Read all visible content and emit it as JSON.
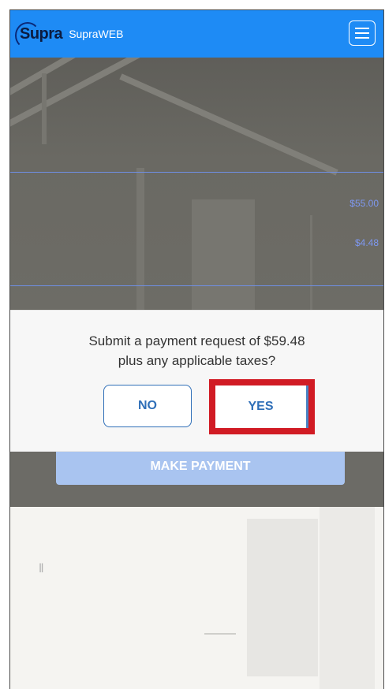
{
  "header": {
    "logo_text": "Supra",
    "brand_text": "SupraWEB",
    "menu_icon": "hamburger-menu-icon"
  },
  "background": {
    "price_1": "$55.00",
    "price_2": "$4.48"
  },
  "dialog": {
    "line1": "Submit a payment request of $59.48",
    "line2": "plus any applicable taxes?",
    "no_label": "NO",
    "yes_label": "YES",
    "highlight_color": "#d11b24"
  },
  "payment": {
    "button_label": "MAKE PAYMENT"
  },
  "colors": {
    "navbar": "#1e8bf5",
    "button_text": "#2f6fb8",
    "make_payment_bg": "#a9c4f0"
  }
}
